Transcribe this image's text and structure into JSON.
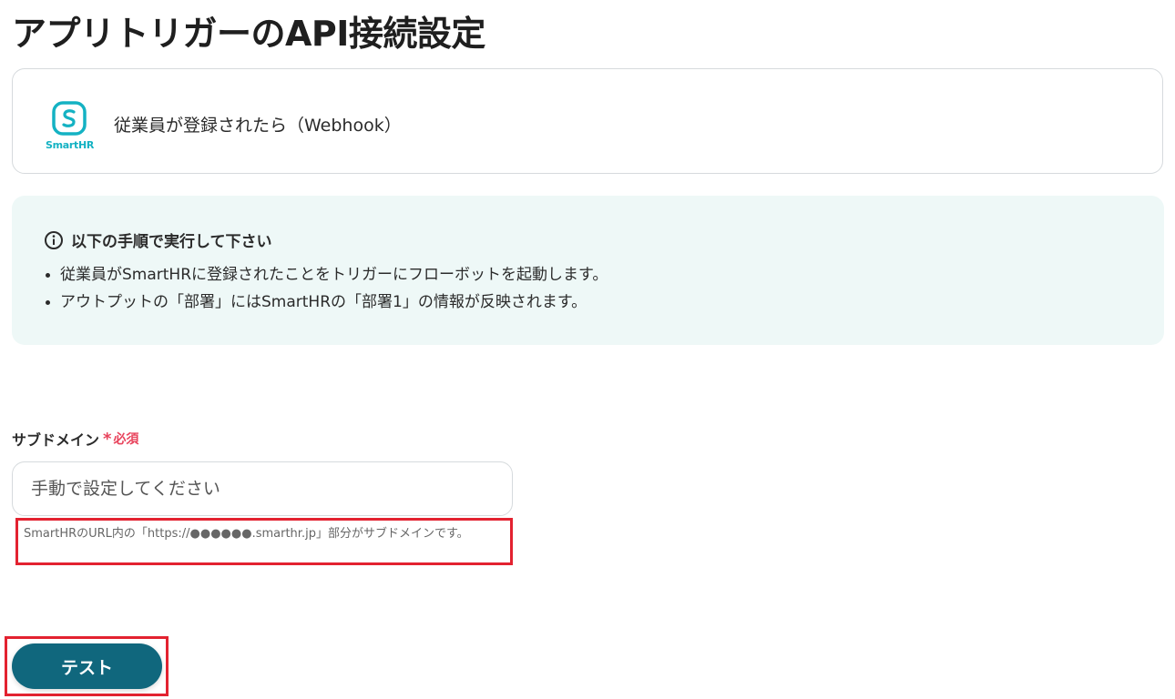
{
  "page": {
    "title": "アプリトリガーのAPI接続設定"
  },
  "trigger": {
    "app_name": "SmartHR",
    "label": "従業員が登録されたら（Webhook）",
    "logo_icon": "smarthr-logo-icon",
    "brand_color": "#14b2c3"
  },
  "instructions": {
    "heading": "以下の手順で実行して下さい",
    "items": [
      "従業員がSmartHRに登録されたことをトリガーにフローボットを起動します。",
      "アウトプットの「部署」にはSmartHRの「部署1」の情報が反映されます。"
    ],
    "background_color": "#eef8f7"
  },
  "subdomain_field": {
    "label": "サブドメイン",
    "required_mark": "*",
    "required_text": "必須",
    "placeholder": "手動で設定してください",
    "value": "",
    "help_text": "SmartHRのURL内の「https://●●●●●●.smarthr.jp」部分がサブドメインです。"
  },
  "actions": {
    "test_label": "テスト",
    "test_color": "#10677d"
  },
  "highlight_color": "#e32230"
}
